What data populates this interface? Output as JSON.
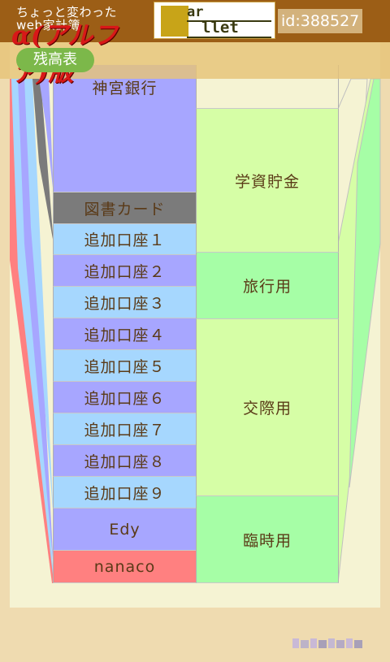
{
  "header": {
    "logo_line1": "ちょっと変わった",
    "logo_line2": "web家計簿",
    "logo_main": "α(アルファ)版",
    "partner_logo": {
      "top": "ar",
      "bottom": "llet"
    },
    "user_id": "id:388527",
    "tab_label": "残高表"
  },
  "accounts": [
    {
      "label": "神宮銀行",
      "color": "#a7a6ff"
    },
    {
      "label": "図書カード",
      "color": "#7b7b7b"
    },
    {
      "label": "追加口座１",
      "color": "#a6d7fe"
    },
    {
      "label": "追加口座２",
      "color": "#a7a6ff"
    },
    {
      "label": "追加口座３",
      "color": "#a6d7fe"
    },
    {
      "label": "追加口座４",
      "color": "#a7a6ff"
    },
    {
      "label": "追加口座５",
      "color": "#a6d7fe"
    },
    {
      "label": "追加口座６",
      "color": "#a7a6ff"
    },
    {
      "label": "追加口座７",
      "color": "#a6d7fe"
    },
    {
      "label": "追加口座８",
      "color": "#a7a6ff"
    },
    {
      "label": "追加口座９",
      "color": "#a6d7fe"
    },
    {
      "label": "Edy",
      "color": "#a7a6ff"
    },
    {
      "label": "nanaco",
      "color": "#ff8080"
    }
  ],
  "funds": [
    {
      "label": "",
      "color": "#f5f3d3"
    },
    {
      "label": "学資貯金",
      "color": "#d6fea6"
    },
    {
      "label": "旅行用",
      "color": "#a6fea6"
    },
    {
      "label": "交際用",
      "color": "#d6fea6"
    },
    {
      "label": "臨時用",
      "color": "#a6fea6"
    }
  ],
  "colors": {
    "header_bar": "#9c5e16",
    "tab_green": "#7cb84a",
    "background": "#efdbb0",
    "panel": "#f5f3d3"
  }
}
